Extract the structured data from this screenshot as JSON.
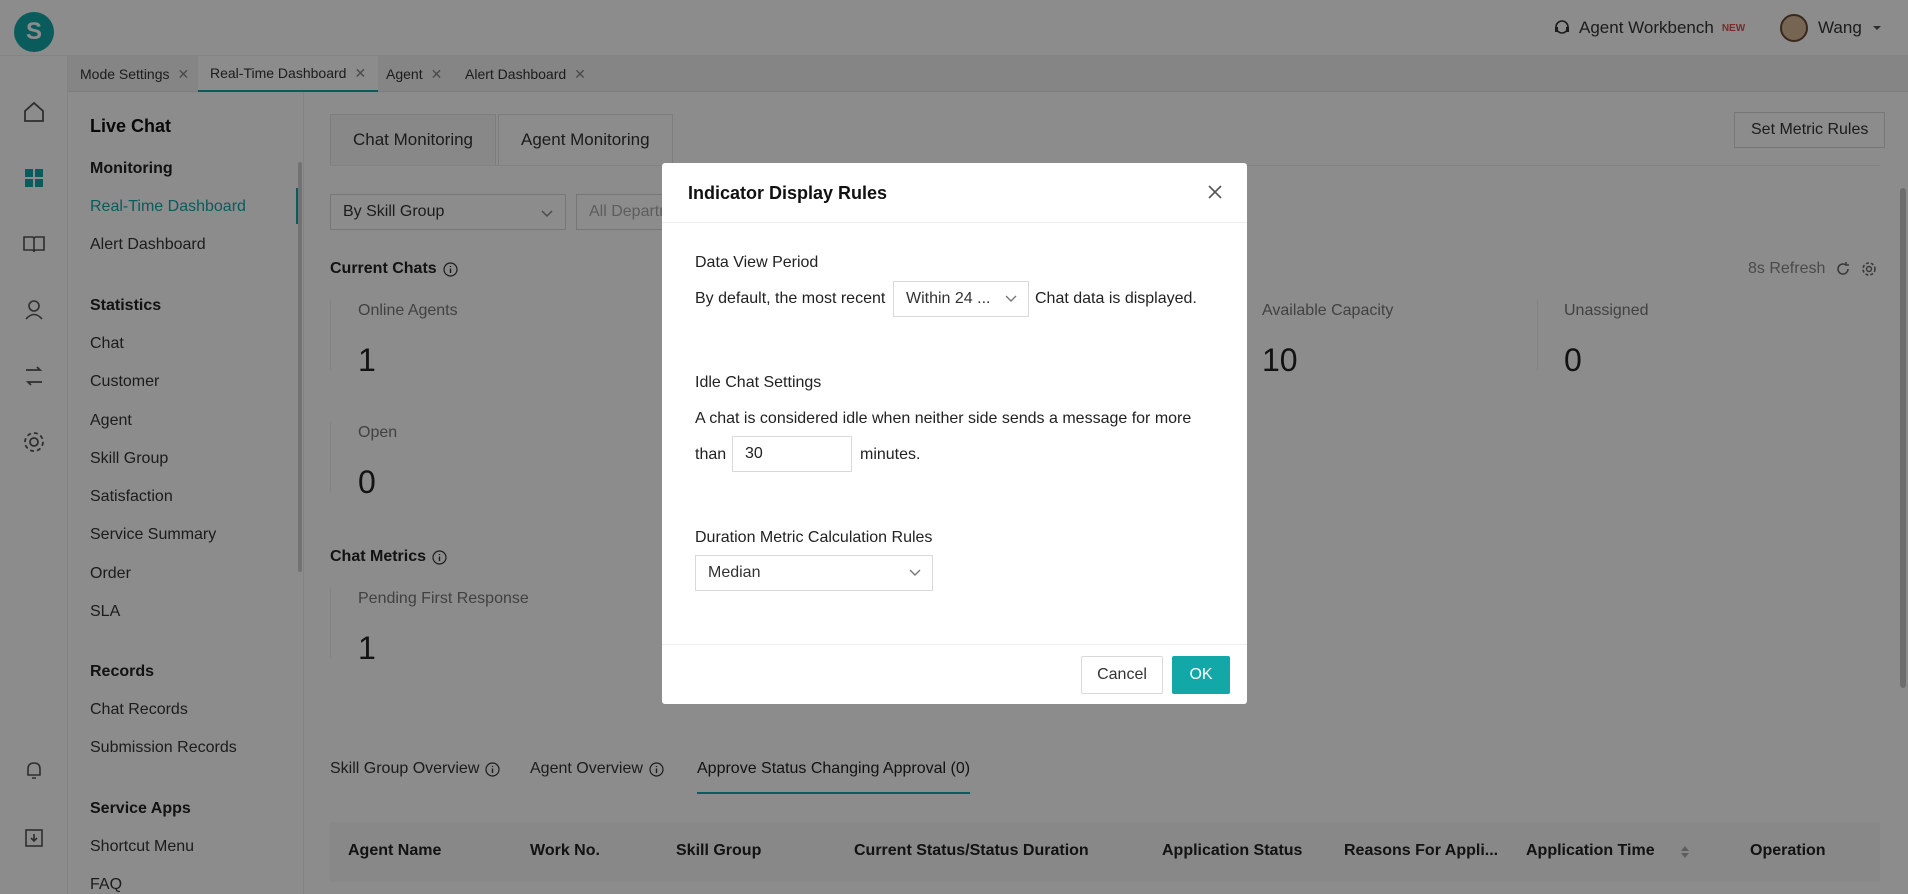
{
  "header": {
    "logo_letter": "S",
    "workbench_label": "Agent Workbench",
    "new_badge": "NEW",
    "user_name": "Wang"
  },
  "tabs": [
    {
      "label": "Mode Settings"
    },
    {
      "label": "Real-Time Dashboard"
    },
    {
      "label": "Agent"
    },
    {
      "label": "Alert Dashboard"
    }
  ],
  "leftnav": {
    "title": "Live Chat",
    "monitoring": "Monitoring",
    "realtime": "Real-Time Dashboard",
    "alert": "Alert Dashboard",
    "statistics": "Statistics",
    "stat_items": [
      "Chat",
      "Customer",
      "Agent",
      "Skill Group",
      "Satisfaction",
      "Service Summary",
      "Order",
      "SLA"
    ],
    "records": "Records",
    "record_items": [
      "Chat Records",
      "Submission Records"
    ],
    "service_apps": "Service Apps",
    "app_items": [
      "Shortcut Menu",
      "FAQ"
    ]
  },
  "main": {
    "tab_chat": "Chat Monitoring",
    "tab_agent": "Agent Monitoring",
    "set_metric": "Set Metric Rules",
    "group_select": "By Skill Group",
    "dept_select": "All Departm",
    "current_chats": "Current Chats",
    "refresh": "8s Refresh",
    "metrics": {
      "online_agents": {
        "label": "Online Agents",
        "value": "1"
      },
      "available_capacity": {
        "label": "Available Capacity",
        "value": "10"
      },
      "unassigned": {
        "label": "Unassigned",
        "value": "0"
      },
      "open": {
        "label": "Open",
        "value": "0"
      }
    },
    "chat_metrics": "Chat Metrics",
    "pending_first_response": {
      "label": "Pending First Response",
      "value": "1"
    },
    "bottom_tabs": [
      "Skill Group Overview",
      "Agent Overview",
      "Approve Status Changing Approval (0)"
    ],
    "table_headers": [
      "Agent Name",
      "Work No.",
      "Skill Group",
      "Current Status/Status Duration",
      "Application Status",
      "Reasons For Appli...",
      "Application Time",
      "Operation"
    ]
  },
  "modal": {
    "title": "Indicator Display Rules",
    "data_view_period": "Data View Period",
    "by_default": "By default, the most recent",
    "within": "Within 24 ...",
    "chat_data": "Chat data is displayed.",
    "idle_settings": "Idle Chat Settings",
    "idle_desc": "A chat is considered idle when neither side sends a message for more",
    "than": "than",
    "idle_value": "30",
    "minutes": "minutes.",
    "duration_rules": "Duration Metric Calculation Rules",
    "duration_value": "Median",
    "cancel": "Cancel",
    "ok": "OK"
  },
  "colors": {
    "accent": "#13a8a8",
    "overlay": "rgba(0,0,0,0.45)"
  }
}
